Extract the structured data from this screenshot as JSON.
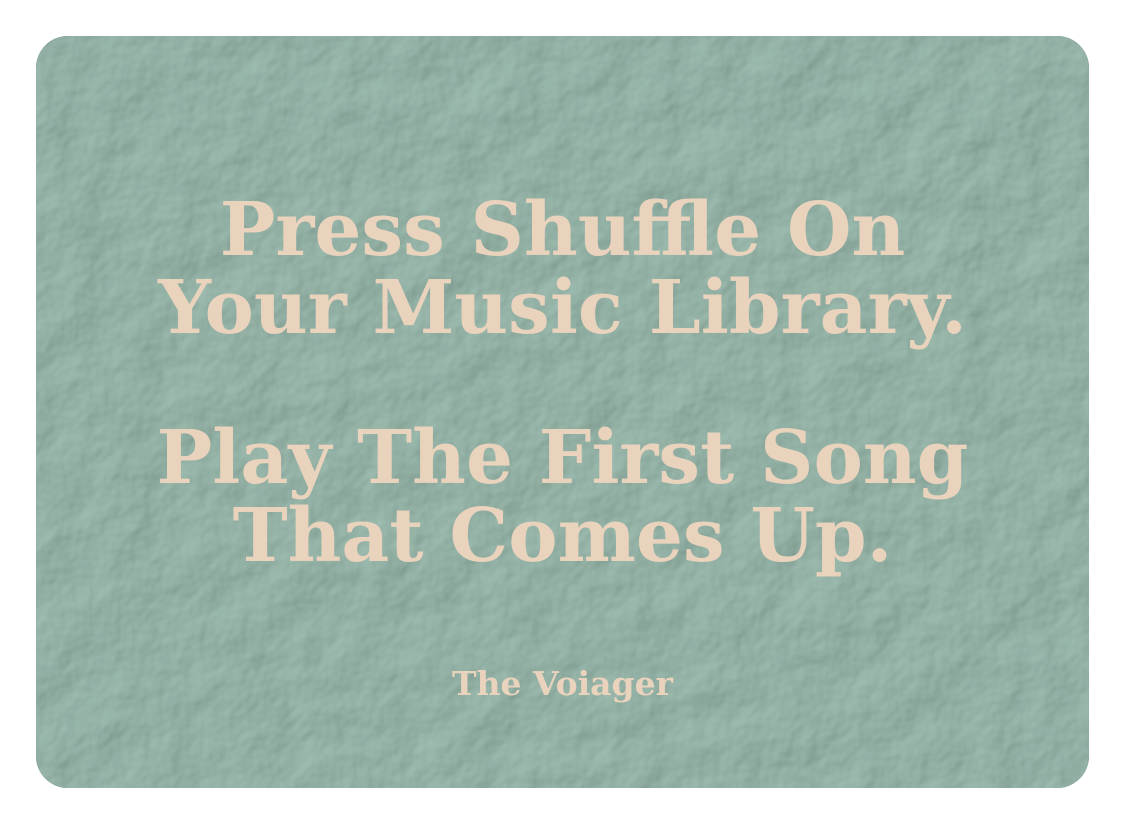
{
  "card": {
    "background_color": "#5f7f72",
    "text_color": "#ead3bd"
  },
  "message": {
    "first": {
      "line1": "Press Shuffle On",
      "line2": "Your Music Library."
    },
    "second": {
      "line1": "Play The First Song",
      "line2": "That Comes Up."
    }
  },
  "attribution": "The Voiager"
}
